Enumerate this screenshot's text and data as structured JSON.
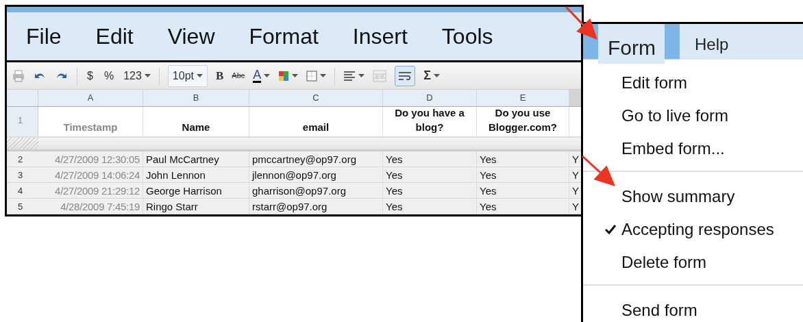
{
  "spreadsheet": {
    "menubar": [
      {
        "label": "File"
      },
      {
        "label": "Edit"
      },
      {
        "label": "View"
      },
      {
        "label": "Format"
      },
      {
        "label": "Insert"
      },
      {
        "label": "Tools"
      }
    ],
    "toolbar": {
      "currency": "$",
      "percent": "%",
      "number_format": "123",
      "font_size": "10pt",
      "bold": "B",
      "strikethrough": "Abc",
      "text_color": "A",
      "function": "Σ",
      "merge_disabled": true,
      "wrap_selected": true
    },
    "columns": [
      {
        "letter": "A"
      },
      {
        "letter": "B"
      },
      {
        "letter": "C"
      },
      {
        "letter": "D"
      },
      {
        "letter": "E"
      }
    ],
    "header_row": {
      "number": "1",
      "cells": [
        {
          "text": "Timestamp",
          "greyed": true
        },
        {
          "text": "Name",
          "greyed": false
        },
        {
          "text": "email",
          "greyed": false
        },
        {
          "text": "Do you have a blog?",
          "greyed": false
        },
        {
          "text": "Do you use Blogger.com?",
          "greyed": false
        }
      ]
    },
    "rows": [
      {
        "number": "2",
        "cells": [
          "4/27/2009 12:30:05",
          "Paul McCartney",
          "pmccartney@op97.org",
          "Yes",
          "Yes"
        ],
        "column_6": "Y"
      },
      {
        "number": "3",
        "cells": [
          "4/27/2009 14:06:24",
          "John Lennon",
          "jlennon@op97.org",
          "Yes",
          "Yes"
        ],
        "column_6": "Y"
      },
      {
        "number": "4",
        "cells": [
          "4/27/2009 21:29:12",
          "George Harrison",
          "gharrison@op97.org",
          "Yes",
          "Yes"
        ],
        "column_6": "Y"
      },
      {
        "number": "5",
        "cells": [
          "4/28/2009 7:45:19",
          "Ringo Starr",
          "rstarr@op97.org",
          "Yes",
          "Yes"
        ],
        "column_6": "Y"
      }
    ]
  },
  "form_menu": {
    "menubar": [
      {
        "label": "Form",
        "selected": true
      },
      {
        "label": "Help",
        "selected": false
      }
    ],
    "groups": [
      [
        {
          "label": "Edit form",
          "checked": false
        },
        {
          "label": "Go to live form",
          "checked": false
        },
        {
          "label": "Embed form...",
          "checked": false
        }
      ],
      [
        {
          "label": "Show summary",
          "checked": false
        },
        {
          "label": "Accepting responses",
          "checked": true
        },
        {
          "label": "Delete form",
          "checked": false
        }
      ],
      [
        {
          "label": "Send form",
          "checked": false
        }
      ]
    ]
  }
}
